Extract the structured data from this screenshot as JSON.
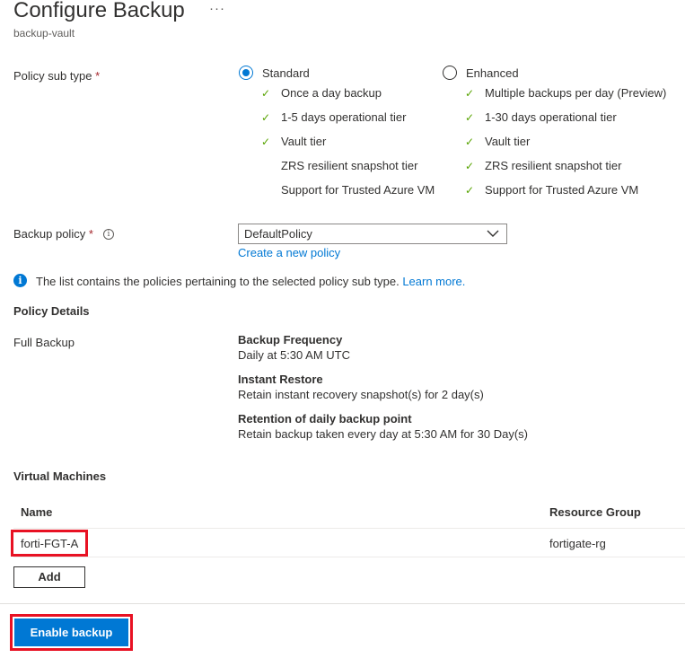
{
  "header": {
    "title": "Configure Backup",
    "more": "···",
    "subtitle": "backup-vault"
  },
  "policy_sub_type": {
    "label": "Policy sub type",
    "required": "*",
    "options": [
      {
        "label": "Standard",
        "selected": true,
        "features": [
          {
            "text": "Once a day backup",
            "check": true
          },
          {
            "text": "1-5 days operational tier",
            "check": true
          },
          {
            "text": "Vault tier",
            "check": true
          },
          {
            "text": "ZRS resilient snapshot tier",
            "check": false
          },
          {
            "text": "Support for Trusted Azure VM",
            "check": false
          }
        ]
      },
      {
        "label": "Enhanced",
        "selected": false,
        "features": [
          {
            "text": "Multiple backups per day (Preview)",
            "check": true
          },
          {
            "text": "1-30 days operational tier",
            "check": true
          },
          {
            "text": "Vault tier",
            "check": true
          },
          {
            "text": "ZRS resilient snapshot tier",
            "check": true
          },
          {
            "text": "Support for Trusted Azure VM",
            "check": true
          }
        ]
      }
    ]
  },
  "backup_policy": {
    "label": "Backup policy",
    "required": "*",
    "value": "DefaultPolicy",
    "create_link": "Create a new policy"
  },
  "info_message": {
    "text": "The list contains the policies pertaining to the selected policy sub type.",
    "link": "Learn more."
  },
  "policy_details": {
    "heading": "Policy Details",
    "type_label": "Full Backup",
    "items": [
      {
        "title": "Backup Frequency",
        "value": "Daily at 5:30 AM UTC"
      },
      {
        "title": "Instant Restore",
        "value": "Retain instant recovery snapshot(s) for 2 day(s)"
      },
      {
        "title": "Retention of daily backup point",
        "value": "Retain backup taken every day at 5:30 AM for 30 Day(s)"
      }
    ]
  },
  "virtual_machines": {
    "heading": "Virtual Machines",
    "columns": [
      "Name",
      "Resource Group"
    ],
    "rows": [
      {
        "name": "forti-FGT-A",
        "resource_group": "fortigate-rg"
      }
    ],
    "add_label": "Add"
  },
  "footer": {
    "enable_label": "Enable backup"
  },
  "colors": {
    "accent": "#0078d4",
    "check": "#57a300",
    "highlight": "#e81123"
  }
}
